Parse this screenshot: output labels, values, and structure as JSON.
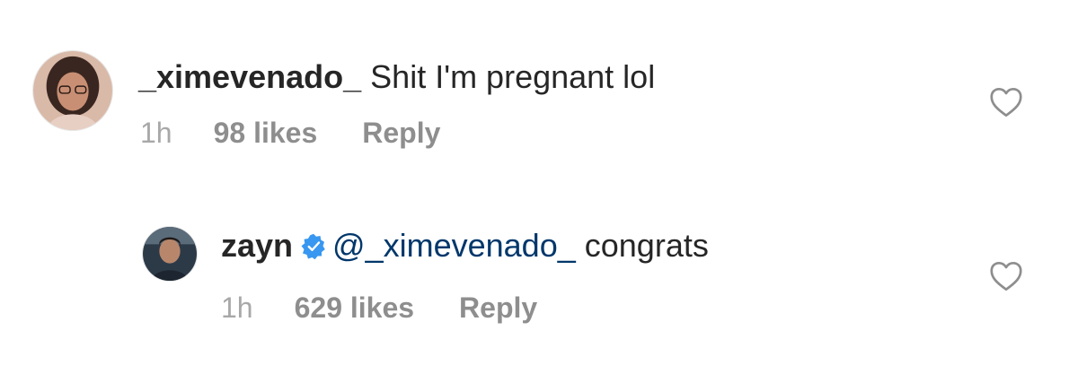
{
  "comments": [
    {
      "username": "_ximevenado_",
      "text": "Shit I'm pregnant lol",
      "time": "1h",
      "likes": "98 likes",
      "reply_label": "Reply",
      "avatar_icon": "user-avatar-photo",
      "like_icon": "heart-outline-icon"
    },
    {
      "username": "zayn",
      "verified": true,
      "verified_icon": "verified-badge-icon",
      "mention": "@_ximevenado_",
      "text": "congrats",
      "time": "1h",
      "likes": "629 likes",
      "reply_label": "Reply",
      "avatar_icon": "user-avatar-photo",
      "like_icon": "heart-outline-icon"
    }
  ],
  "colors": {
    "text": "#262626",
    "muted": "#8e8e8e",
    "mention": "#00376b",
    "verified": "#3897f0"
  }
}
